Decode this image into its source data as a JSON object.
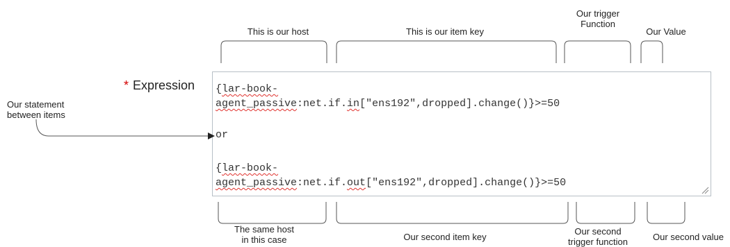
{
  "annotations": {
    "host_label": "This is our host",
    "item_key_label": "This is our item key",
    "trigger_function_label_line1": "Our trigger",
    "trigger_function_label_line2": "Function",
    "value_label": "Our Value",
    "statement_label_line1": "Our statement",
    "statement_label_line2": "between items",
    "same_host_line1": "The same host",
    "same_host_line2": "in this case",
    "second_item_key_label": "Our second item key",
    "second_trigger_line1": "Our second",
    "second_trigger_line2": "trigger function",
    "second_value_label": "Our second value"
  },
  "form": {
    "required_marker": "*",
    "field_label": "Expression"
  },
  "expression": {
    "line1_brace": "{",
    "line1_host": "lar-book-",
    "line2_host": "agent_passive",
    "line2_key_prefix": ":net.if.",
    "line2_key_word": "in",
    "line2_rest": "[\"ens192\",dropped].change()}>=50",
    "operator": "or",
    "line4_brace": "{",
    "line4_host": "lar-book-",
    "line5_host": "agent_passive",
    "line5_key_prefix": ":net.if.",
    "line5_key_word": "out",
    "line5_rest": "[\"ens192\",dropped].change()}>=50"
  },
  "colors": {
    "required": "#d40000",
    "spellcheck": "#e0322e",
    "textarea_border": "#b7bfc6",
    "bracket_line": "#555555"
  }
}
